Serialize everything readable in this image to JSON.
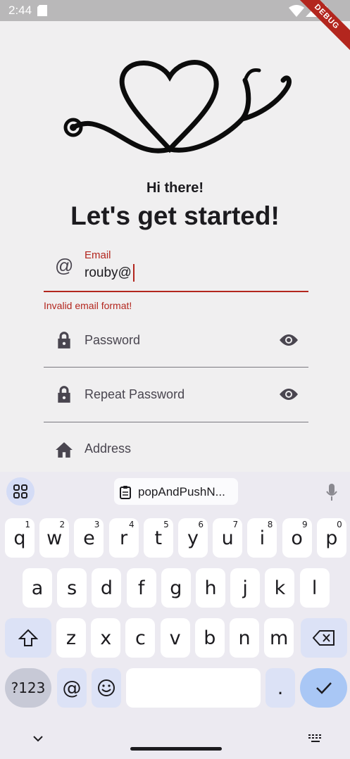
{
  "status_bar": {
    "time": "2:44",
    "debug_label": "DEBUG"
  },
  "header": {
    "greeting": "Hi there!",
    "headline": "Let's get started!"
  },
  "form": {
    "email": {
      "label": "Email",
      "value": "rouby@",
      "error": "Invalid email format!"
    },
    "password": {
      "label": "Password"
    },
    "repeat_password": {
      "label": "Repeat Password"
    },
    "address": {
      "label": "Address"
    }
  },
  "keyboard": {
    "suggestion": "popAndPushN...",
    "row1": [
      {
        "key": "q",
        "num": "1"
      },
      {
        "key": "w",
        "num": "2"
      },
      {
        "key": "e",
        "num": "3"
      },
      {
        "key": "r",
        "num": "4"
      },
      {
        "key": "t",
        "num": "5"
      },
      {
        "key": "y",
        "num": "6"
      },
      {
        "key": "u",
        "num": "7"
      },
      {
        "key": "i",
        "num": "8"
      },
      {
        "key": "o",
        "num": "9"
      },
      {
        "key": "p",
        "num": "0"
      }
    ],
    "row2": [
      "a",
      "s",
      "d",
      "f",
      "g",
      "h",
      "j",
      "k",
      "l"
    ],
    "row3": [
      "z",
      "x",
      "c",
      "v",
      "b",
      "n",
      "m"
    ],
    "symbols_label": "?123",
    "at_label": "@",
    "period_label": "."
  },
  "colors": {
    "error": "#b3261e",
    "background": "#f0eff0",
    "enter_key": "#a9c7f5"
  }
}
